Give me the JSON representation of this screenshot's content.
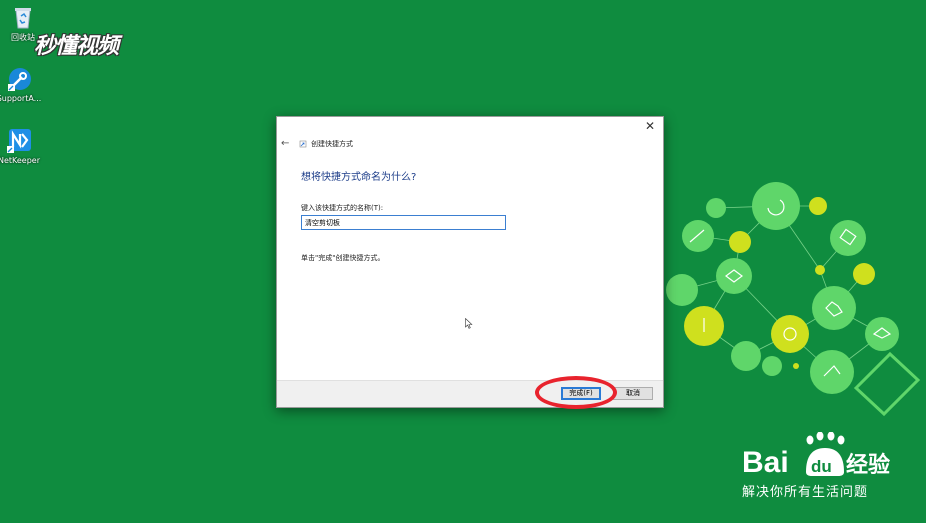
{
  "desktop": {
    "icons": [
      {
        "label": "回收站"
      },
      {
        "label": "SupportA..."
      },
      {
        "label": "NetKeeper"
      }
    ]
  },
  "watermark": {
    "text": "秒懂视频"
  },
  "dialog": {
    "title": "创建快捷方式",
    "heading": "想将快捷方式命名为什么?",
    "field_label": "键入该快捷方式的名称(T):",
    "name_value": "清空剪切板",
    "hint": "单击\"完成\"创建快捷方式。",
    "finish_label": "完成(F)",
    "cancel_label": "取消",
    "close_symbol": "✕",
    "back_symbol": "←"
  },
  "branding": {
    "slogan": "解决你所有生活问题",
    "logo_text": "Bai",
    "logo_paw_text": "du",
    "logo_suffix": "经验"
  },
  "colors": {
    "desktop_bg": "#0f8c3f",
    "dialog_heading": "#1e3e8a",
    "input_border": "#3b7fd1",
    "highlight_ring": "#e8232d",
    "decor_green": "#5fd66a",
    "decor_yellow": "#cfe01e"
  }
}
